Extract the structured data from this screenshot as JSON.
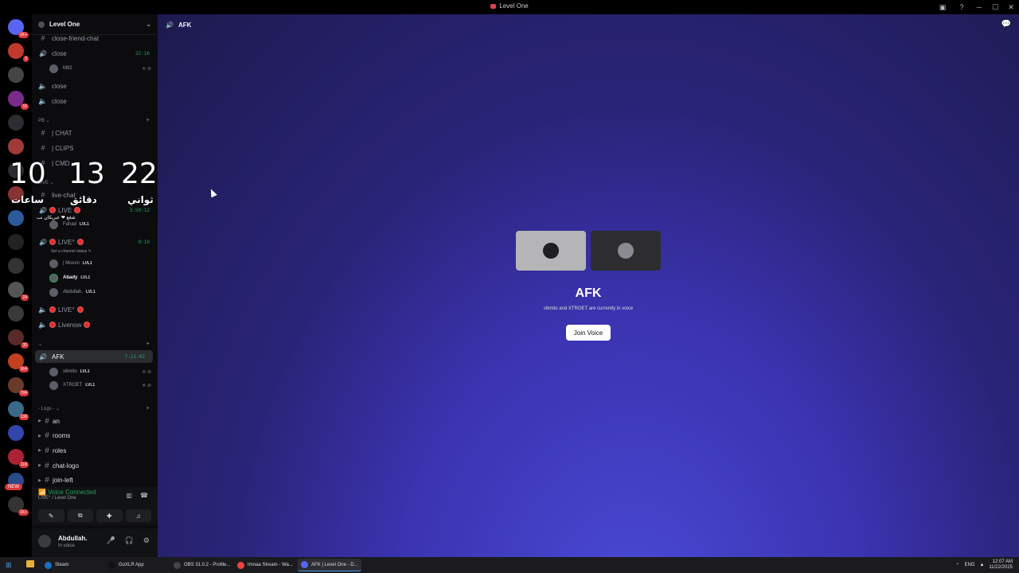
{
  "window": {
    "title": "Level One"
  },
  "guild_badges": [
    "1K+",
    "3",
    "",
    "15",
    "",
    "",
    "",
    "",
    "",
    "",
    "",
    "24",
    "",
    "30",
    "364",
    "784",
    "138",
    "",
    "118",
    "",
    "1K+"
  ],
  "guild_new": "NEW",
  "sidebar": {
    "server_name": "Level One",
    "channels": {
      "close_friend_chat": "close-friend-chat",
      "close1": {
        "label": "close",
        "time": "22:16"
      },
      "close1_user": "M92",
      "close2": "close",
      "close3": "close",
      "pb_category": "PB ⌄",
      "chat": "| CHAT",
      "clips": "| CLIPS",
      "cmd": "| CMD",
      "live_category": "LIVE ⌄",
      "live_chat": "live-chat",
      "live1": {
        "label": "LIVE",
        "time": "3:50:12"
      },
      "live1_user": "Fahad",
      "live2": {
        "label": "LIVE°",
        "time": "9:10",
        "status": "Set a channel status ✎"
      },
      "live2_users": [
        {
          "name": "| Muvxn",
          "lvl": "LVL1"
        },
        {
          "name": "Abady",
          "lvl": "LVL1"
        },
        {
          "name": "Abdullah.",
          "lvl": "LVL1"
        }
      ],
      "live3": "LIVE°",
      "livenow": "Livenow",
      "afk_category": "⌄",
      "afk": {
        "label": "AFK",
        "time": "7:11:02"
      },
      "afk_users": [
        {
          "name": "s6mito",
          "lvl": "LVL1"
        },
        {
          "name": "XTROET",
          "lvl": "LVL1"
        }
      ],
      "logs_category": "- Logs - ⌄",
      "logs": [
        "an",
        "rooms",
        "roles",
        "chat-logo",
        "join-left"
      ]
    },
    "lvl1_label": "LVL1"
  },
  "clock": {
    "hours": "10",
    "minutes": "13",
    "seconds": "22",
    "hours_label": "ساعات",
    "minutes_label": "دقائق",
    "seconds_label": "ثواني",
    "footer": "شغع ❤ عبريكان نب"
  },
  "voice_panel": {
    "status": "Voice Connected",
    "channel": "LIVE° / Level One"
  },
  "user_panel": {
    "name": "Abdullah.",
    "status": "In voice"
  },
  "main": {
    "header": "AFK",
    "title": "AFK",
    "subtitle": "s6mito and XTROET are currently in voice",
    "join_button": "Join Voice"
  },
  "taskbar": {
    "tasks": [
      "Steam",
      "GoXLR App",
      "OBS 31.0.2 - Profile...",
      "tmnaa Stream - Wa...",
      "AFK | Level One - D..."
    ],
    "lang": "ENG",
    "time": "12:07 AM",
    "date": "11/22/2025"
  },
  "colors": {
    "accent_green": "#23a55a",
    "live_red": "#e03030",
    "main_bg": "#3b33b0"
  }
}
